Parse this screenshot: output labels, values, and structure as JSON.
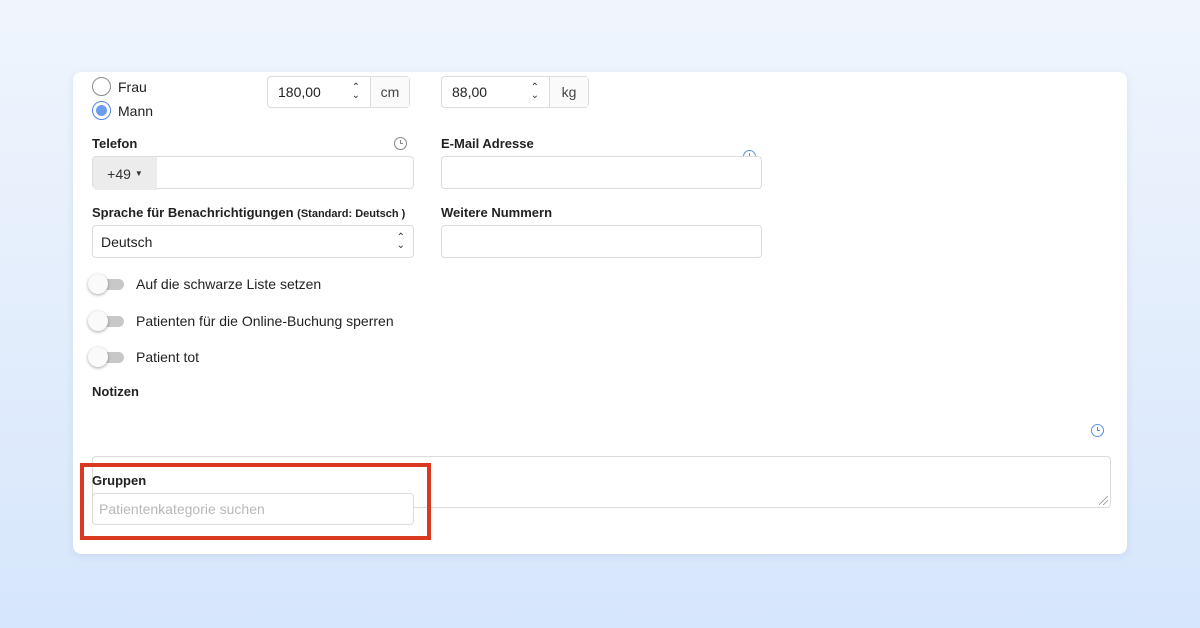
{
  "gender": {
    "options": [
      {
        "label": "Frau",
        "checked": false
      },
      {
        "label": "Mann",
        "checked": true
      }
    ]
  },
  "height": {
    "value": "180,00",
    "unit": "cm"
  },
  "weight": {
    "value": "88,00",
    "unit": "kg"
  },
  "phone": {
    "label": "Telefon",
    "prefix": "+49",
    "value": "",
    "history_icon": "clock-icon"
  },
  "email": {
    "label": "E-Mail Adresse",
    "value": "",
    "history_icon": "clock-icon"
  },
  "language": {
    "label": "Sprache für Benachrichtigungen",
    "sublabel": "(Standard: Deutsch )",
    "selected": "Deutsch"
  },
  "other_numbers": {
    "label": "Weitere Nummern",
    "value": "",
    "history_icon": "clock-icon"
  },
  "toggles": [
    {
      "label": "Auf die schwarze Liste setzen",
      "on": false
    },
    {
      "label": "Patienten für die Online-Buchung sperren",
      "on": false
    },
    {
      "label": "Patient tot",
      "on": false
    }
  ],
  "notes": {
    "label": "Notizen",
    "value": "",
    "history_icon": "clock-icon"
  },
  "groups": {
    "label": "Gruppen",
    "placeholder": "Patientenkategorie suchen"
  },
  "colors": {
    "accent": "#5b8fe3",
    "highlight": "#d8391f",
    "background": "#e3edfb"
  }
}
